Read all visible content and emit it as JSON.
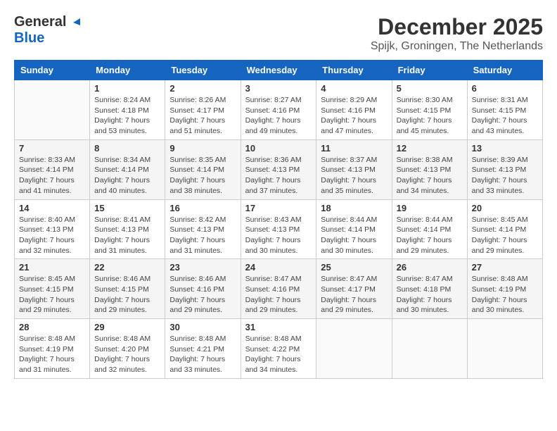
{
  "header": {
    "logo_general": "General",
    "logo_blue": "Blue",
    "month_title": "December 2025",
    "location": "Spijk, Groningen, The Netherlands"
  },
  "calendar": {
    "days_of_week": [
      "Sunday",
      "Monday",
      "Tuesday",
      "Wednesday",
      "Thursday",
      "Friday",
      "Saturday"
    ],
    "weeks": [
      [
        {
          "day": "",
          "info": ""
        },
        {
          "day": "1",
          "info": "Sunrise: 8:24 AM\nSunset: 4:18 PM\nDaylight: 7 hours\nand 53 minutes."
        },
        {
          "day": "2",
          "info": "Sunrise: 8:26 AM\nSunset: 4:17 PM\nDaylight: 7 hours\nand 51 minutes."
        },
        {
          "day": "3",
          "info": "Sunrise: 8:27 AM\nSunset: 4:16 PM\nDaylight: 7 hours\nand 49 minutes."
        },
        {
          "day": "4",
          "info": "Sunrise: 8:29 AM\nSunset: 4:16 PM\nDaylight: 7 hours\nand 47 minutes."
        },
        {
          "day": "5",
          "info": "Sunrise: 8:30 AM\nSunset: 4:15 PM\nDaylight: 7 hours\nand 45 minutes."
        },
        {
          "day": "6",
          "info": "Sunrise: 8:31 AM\nSunset: 4:15 PM\nDaylight: 7 hours\nand 43 minutes."
        }
      ],
      [
        {
          "day": "7",
          "info": "Sunrise: 8:33 AM\nSunset: 4:14 PM\nDaylight: 7 hours\nand 41 minutes."
        },
        {
          "day": "8",
          "info": "Sunrise: 8:34 AM\nSunset: 4:14 PM\nDaylight: 7 hours\nand 40 minutes."
        },
        {
          "day": "9",
          "info": "Sunrise: 8:35 AM\nSunset: 4:14 PM\nDaylight: 7 hours\nand 38 minutes."
        },
        {
          "day": "10",
          "info": "Sunrise: 8:36 AM\nSunset: 4:13 PM\nDaylight: 7 hours\nand 37 minutes."
        },
        {
          "day": "11",
          "info": "Sunrise: 8:37 AM\nSunset: 4:13 PM\nDaylight: 7 hours\nand 35 minutes."
        },
        {
          "day": "12",
          "info": "Sunrise: 8:38 AM\nSunset: 4:13 PM\nDaylight: 7 hours\nand 34 minutes."
        },
        {
          "day": "13",
          "info": "Sunrise: 8:39 AM\nSunset: 4:13 PM\nDaylight: 7 hours\nand 33 minutes."
        }
      ],
      [
        {
          "day": "14",
          "info": "Sunrise: 8:40 AM\nSunset: 4:13 PM\nDaylight: 7 hours\nand 32 minutes."
        },
        {
          "day": "15",
          "info": "Sunrise: 8:41 AM\nSunset: 4:13 PM\nDaylight: 7 hours\nand 31 minutes."
        },
        {
          "day": "16",
          "info": "Sunrise: 8:42 AM\nSunset: 4:13 PM\nDaylight: 7 hours\nand 31 minutes."
        },
        {
          "day": "17",
          "info": "Sunrise: 8:43 AM\nSunset: 4:13 PM\nDaylight: 7 hours\nand 30 minutes."
        },
        {
          "day": "18",
          "info": "Sunrise: 8:44 AM\nSunset: 4:14 PM\nDaylight: 7 hours\nand 30 minutes."
        },
        {
          "day": "19",
          "info": "Sunrise: 8:44 AM\nSunset: 4:14 PM\nDaylight: 7 hours\nand 29 minutes."
        },
        {
          "day": "20",
          "info": "Sunrise: 8:45 AM\nSunset: 4:14 PM\nDaylight: 7 hours\nand 29 minutes."
        }
      ],
      [
        {
          "day": "21",
          "info": "Sunrise: 8:45 AM\nSunset: 4:15 PM\nDaylight: 7 hours\nand 29 minutes."
        },
        {
          "day": "22",
          "info": "Sunrise: 8:46 AM\nSunset: 4:15 PM\nDaylight: 7 hours\nand 29 minutes."
        },
        {
          "day": "23",
          "info": "Sunrise: 8:46 AM\nSunset: 4:16 PM\nDaylight: 7 hours\nand 29 minutes."
        },
        {
          "day": "24",
          "info": "Sunrise: 8:47 AM\nSunset: 4:16 PM\nDaylight: 7 hours\nand 29 minutes."
        },
        {
          "day": "25",
          "info": "Sunrise: 8:47 AM\nSunset: 4:17 PM\nDaylight: 7 hours\nand 29 minutes."
        },
        {
          "day": "26",
          "info": "Sunrise: 8:47 AM\nSunset: 4:18 PM\nDaylight: 7 hours\nand 30 minutes."
        },
        {
          "day": "27",
          "info": "Sunrise: 8:48 AM\nSunset: 4:19 PM\nDaylight: 7 hours\nand 30 minutes."
        }
      ],
      [
        {
          "day": "28",
          "info": "Sunrise: 8:48 AM\nSunset: 4:19 PM\nDaylight: 7 hours\nand 31 minutes."
        },
        {
          "day": "29",
          "info": "Sunrise: 8:48 AM\nSunset: 4:20 PM\nDaylight: 7 hours\nand 32 minutes."
        },
        {
          "day": "30",
          "info": "Sunrise: 8:48 AM\nSunset: 4:21 PM\nDaylight: 7 hours\nand 33 minutes."
        },
        {
          "day": "31",
          "info": "Sunrise: 8:48 AM\nSunset: 4:22 PM\nDaylight: 7 hours\nand 34 minutes."
        },
        {
          "day": "",
          "info": ""
        },
        {
          "day": "",
          "info": ""
        },
        {
          "day": "",
          "info": ""
        }
      ]
    ]
  }
}
